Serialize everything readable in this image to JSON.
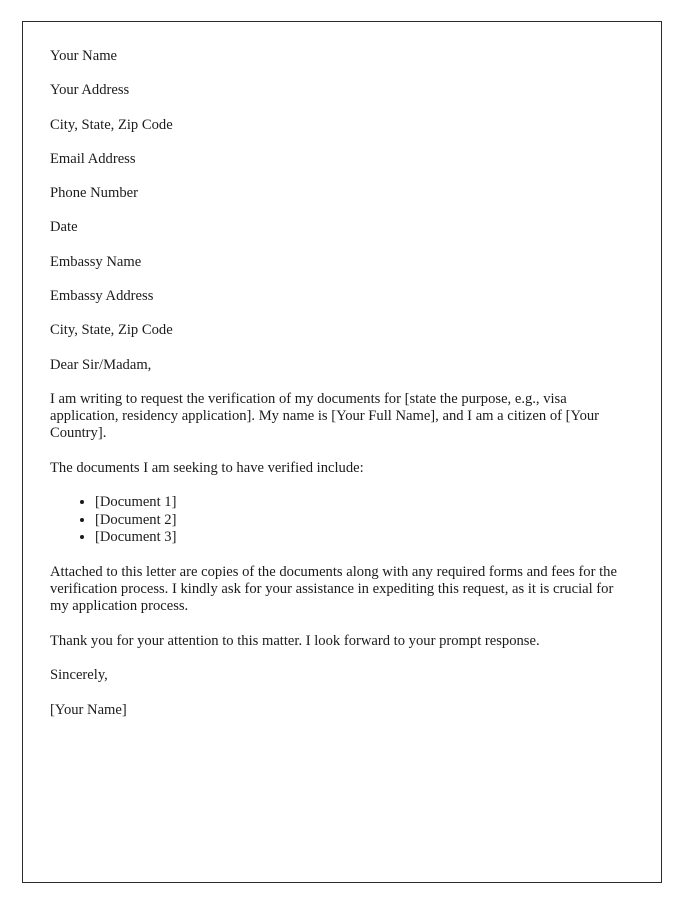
{
  "document": {
    "type": "letter",
    "sender_block": [
      {
        "text": "Your Name"
      },
      {
        "text": "Your Address"
      },
      {
        "text": "City, State, Zip Code"
      },
      {
        "text": "Email Address"
      },
      {
        "text": "Phone Number"
      },
      {
        "text": "Date"
      }
    ],
    "recipient_block": [
      {
        "text": "Embassy Name"
      },
      {
        "text": "Embassy Address"
      },
      {
        "text": "City, State, Zip Code"
      }
    ],
    "salutation": "Dear Sir/Madam,",
    "paragraphs": {
      "intro": "I am writing to request the verification of my documents for [state the purpose, e.g., visa application, residency application]. My name is [Your Full Name], and I am a citizen of [Your Country].",
      "list_lead_in": "The documents I am seeking to have verified include:",
      "attachments": "Attached to this letter are copies of the documents along with any required forms and fees for the verification process. I kindly ask for your assistance in expediting this request, as it is crucial for my application process.",
      "thanks": "Thank you for your attention to this matter. I look forward to your prompt response."
    },
    "document_list": [
      "[Document 1]",
      "[Document 2]",
      "[Document 3]"
    ],
    "closing": {
      "valediction": "Sincerely,",
      "signature": "[Your Name]"
    },
    "style": {
      "text_color": "#1b1b1b",
      "page_background": "#ffffff",
      "border_color": "#2b2b2b",
      "bullet_marker": "disc"
    }
  }
}
